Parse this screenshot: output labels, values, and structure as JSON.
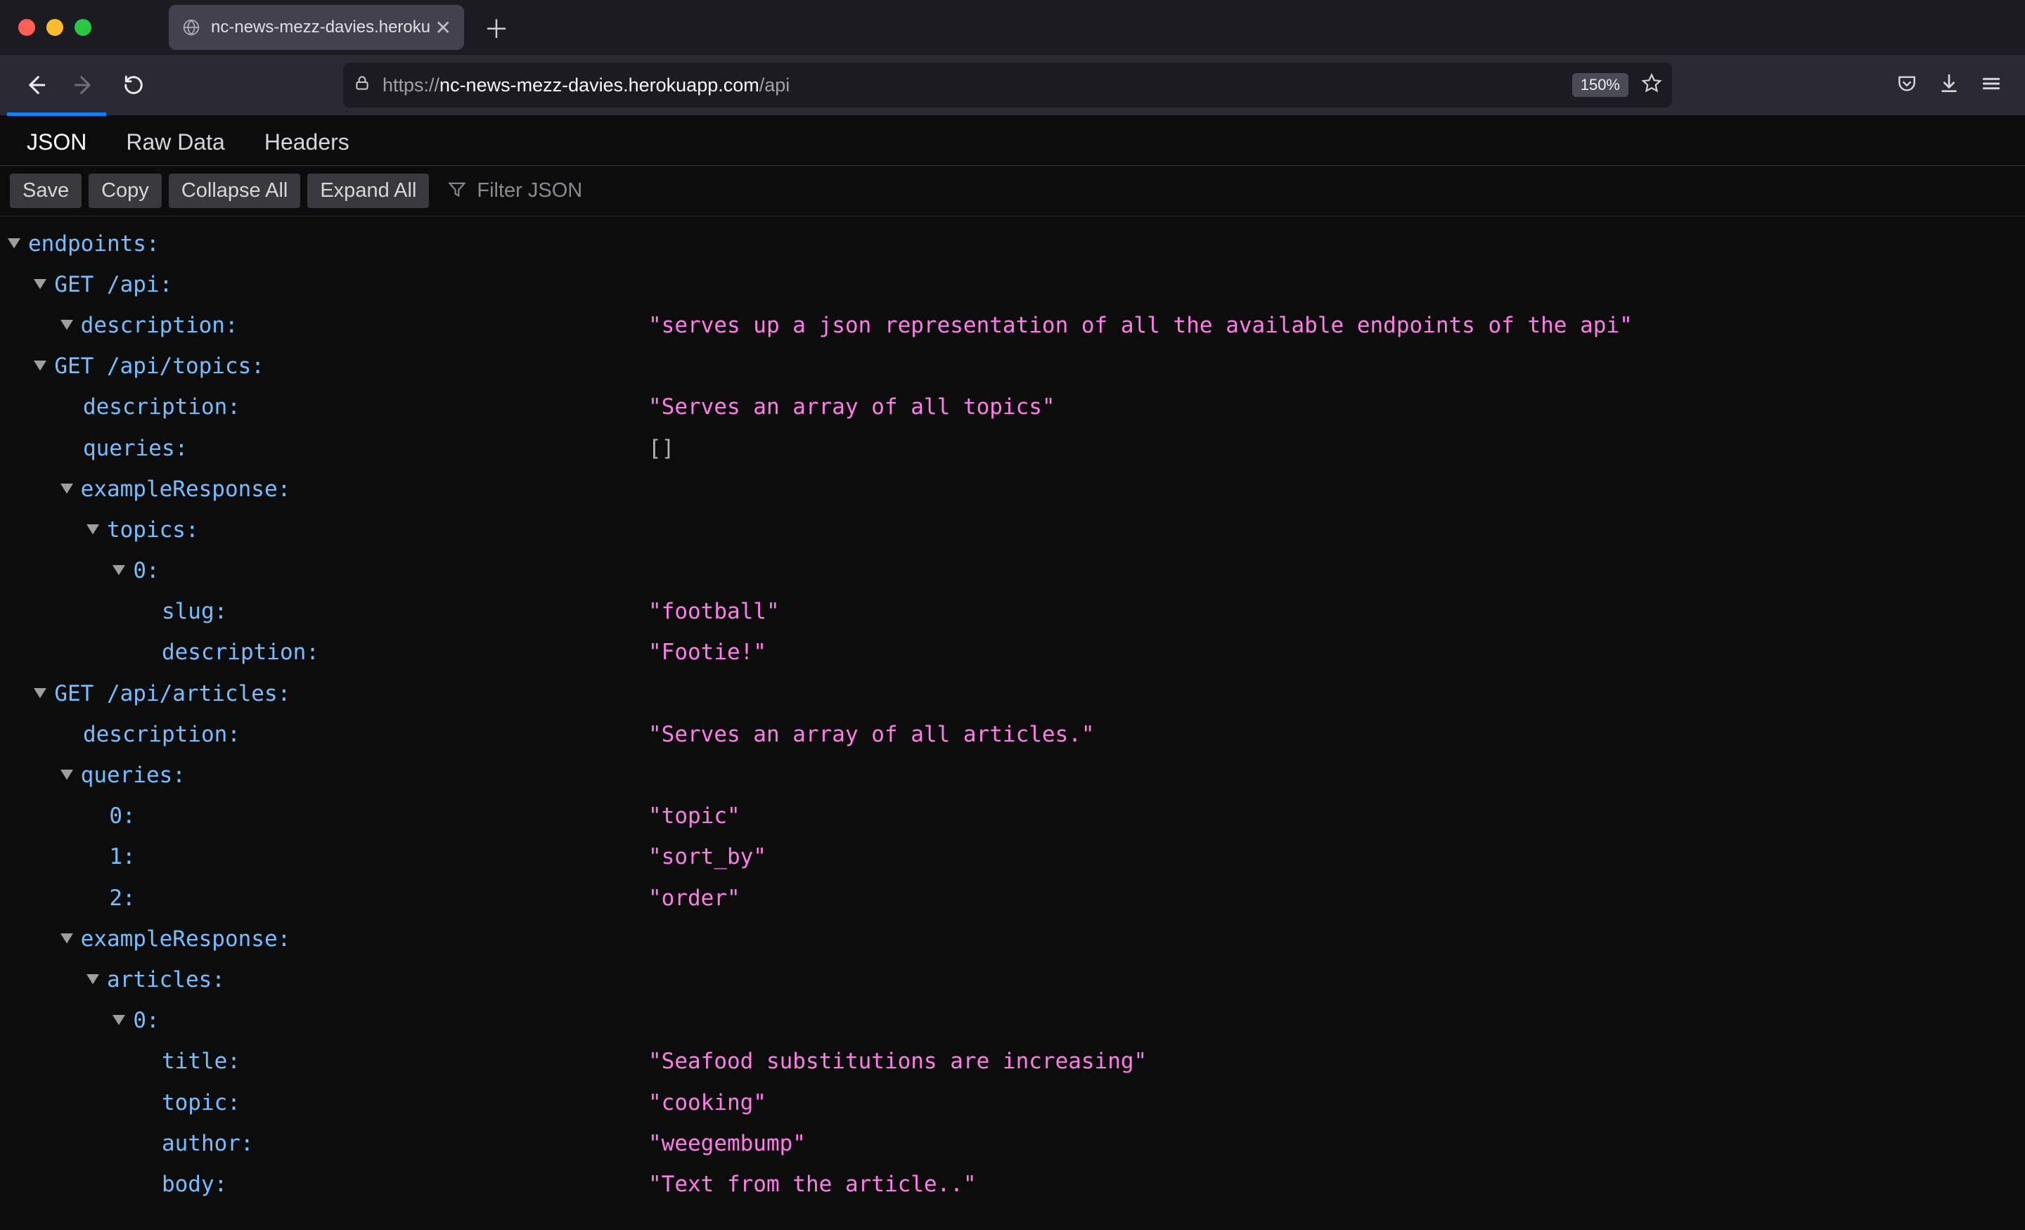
{
  "browser": {
    "tab_title": "nc-news-mezz-davies.herokuapp.co",
    "url_proto": "https://",
    "url_domain": "nc-news-mezz-davies.herokuapp.com",
    "url_path": "/api",
    "zoom": "150%"
  },
  "viewer": {
    "tabs": {
      "json": "JSON",
      "raw": "Raw Data",
      "headers": "Headers"
    },
    "toolbar": {
      "save": "Save",
      "copy": "Copy",
      "collapse": "Collapse All",
      "expand": "Expand All"
    },
    "filter_placeholder": "Filter JSON"
  },
  "tree": {
    "endpoints_key": "endpoints:",
    "get_api_key": "GET /api:",
    "description_key": "description:",
    "get_api_desc": "\"serves up a json representation of all the available endpoints of the api\"",
    "get_topics_key": "GET /api/topics:",
    "topics_desc": "\"Serves an array of all topics\"",
    "queries_key": "queries:",
    "empty_arr": "[]",
    "example_response_key": "exampleResponse:",
    "topics_key": "topics:",
    "idx0_key": "0:",
    "idx1_key": "1:",
    "idx2_key": "2:",
    "slug_key": "slug:",
    "slug_val": "\"football\"",
    "topic_desc_key": "description:",
    "topic_desc_val": "\"Footie!\"",
    "get_articles_key": "GET /api/articles:",
    "articles_desc": "\"Serves an array of all articles.\"",
    "q0": "\"topic\"",
    "q1": "\"sort_by\"",
    "q2": "\"order\"",
    "articles_key": "articles:",
    "title_key": "title:",
    "title_val": "\"Seafood substitutions are increasing\"",
    "topic_key": "topic:",
    "topic_val": "\"cooking\"",
    "author_key": "author:",
    "author_val": "\"weegembump\"",
    "body_key": "body:",
    "body_val": "\"Text from the article..\""
  }
}
